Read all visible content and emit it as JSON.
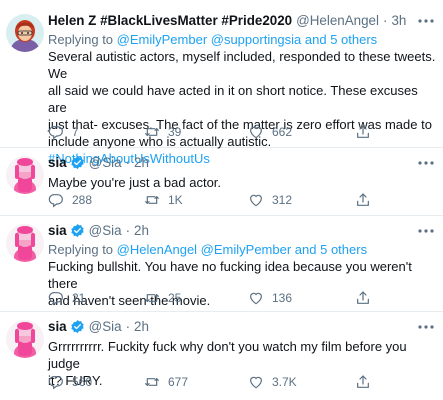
{
  "tweets": [
    {
      "display_name": "Helen Z #BlackLivesMatter #Pride2020",
      "handle": "@HelenAngel",
      "separator": "·",
      "time": "3h",
      "replying_prefix": "Replying to ",
      "replying_mentions": "@EmilyPember @supportingsia",
      "replying_suffix": " and 5 others",
      "text_lines": [
        "Several autistic actors, myself included, responded to these tweets. We",
        "all said we could have acted in it on short notice. These excuses are",
        "just that- excuses. The fact of the matter is zero effort was made to",
        "include anyone who is actually autistic."
      ],
      "hashtag": "#NothingAboutUsWithoutUs",
      "replies": "7",
      "retweets": "39",
      "likes": "662",
      "avatar_icon": "avatar-cartoon-red-hair"
    },
    {
      "display_name": "sia",
      "handle": "@Sia",
      "separator": "·",
      "time": "2h",
      "text": "Maybe you're just a bad actor.",
      "replies": "288",
      "retweets": "1K",
      "likes": "312",
      "avatar_icon": "avatar-pink-figure"
    },
    {
      "display_name": "sia",
      "handle": "@Sia",
      "separator": "·",
      "time": "2h",
      "replying_prefix": "Replying to ",
      "replying_mentions": "@HelenAngel @EmilyPember",
      "replying_suffix": " and 5 others",
      "text_lines": [
        "Fucking bullshit. You have no fucking idea because you weren't there",
        "and haven't seen the movie."
      ],
      "replies": "21",
      "retweets": "25",
      "likes": "136",
      "avatar_icon": "avatar-pink-figure"
    },
    {
      "display_name": "sia",
      "handle": "@Sia",
      "separator": "·",
      "time": "2h",
      "text_lines": [
        "Grrrrrrrrrr. Fuckity fuck why don't you watch my film before you judge",
        "it? FURY."
      ],
      "replies": "560",
      "retweets": "677",
      "likes": "3.7K",
      "avatar_icon": "avatar-pink-figure"
    }
  ],
  "colors": {
    "link": "#1da1f2",
    "secondary_text": "#5b7083",
    "primary_text": "#0f1419",
    "divider": "#e6ecf0",
    "verified": "#1da1f2"
  }
}
